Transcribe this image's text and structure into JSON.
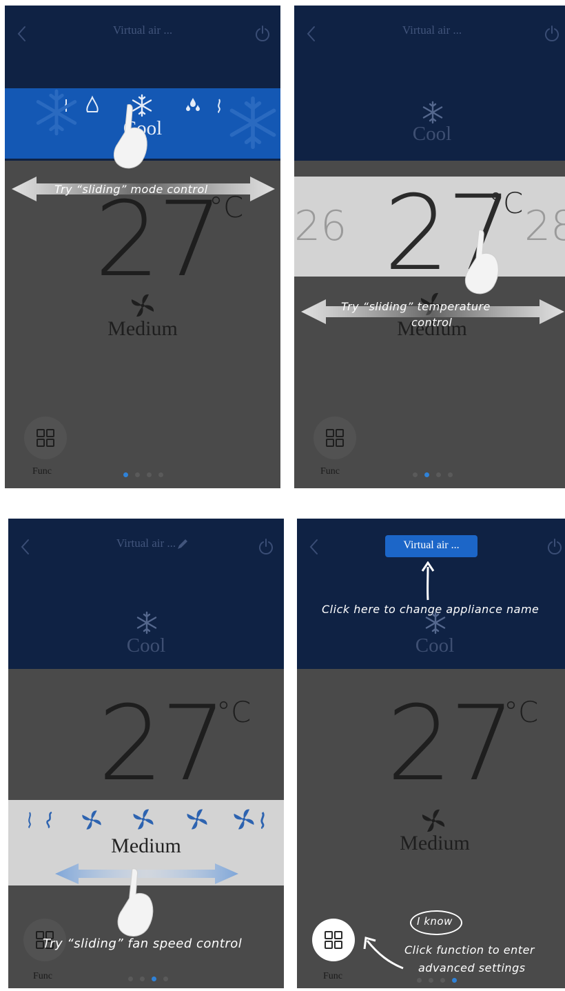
{
  "app": {
    "appliance_name": "Virtual air ..."
  },
  "status": {
    "mode": "Cool",
    "temperature": "27",
    "unit": "°C",
    "prev_temperature": "26",
    "next_temperature": "28",
    "fan_speed": "Medium",
    "func_label": "Func"
  },
  "pages": {
    "count": 4,
    "active": [
      1,
      2,
      3,
      4
    ]
  },
  "tutorial": {
    "step1_hint": "Try “sliding” mode control",
    "step2_hint_line1": "Try “sliding” temperature",
    "step2_hint_line2": "control",
    "step3_hint": "Try “sliding” fan speed control",
    "step4_name_hint": "Click here to change appliance name",
    "step4_func_hint_line1": "Click function to enter",
    "step4_func_hint_line2": "advanced settings",
    "i_know_button": "I know"
  },
  "icons": [
    "back-chevron-icon",
    "power-icon",
    "snowflake-icon",
    "auto-mode-icon",
    "dry-mode-icon",
    "fan-icon",
    "grid-icon",
    "pencil-icon",
    "hand-pointer-icon"
  ],
  "colors": {
    "nav_bg": "#0f2244",
    "mode_band": "#1458b4",
    "slider_band": "#d3d3d3",
    "body_overlay": "#4a4a4a",
    "page_dot_active": "#2f82d8"
  }
}
